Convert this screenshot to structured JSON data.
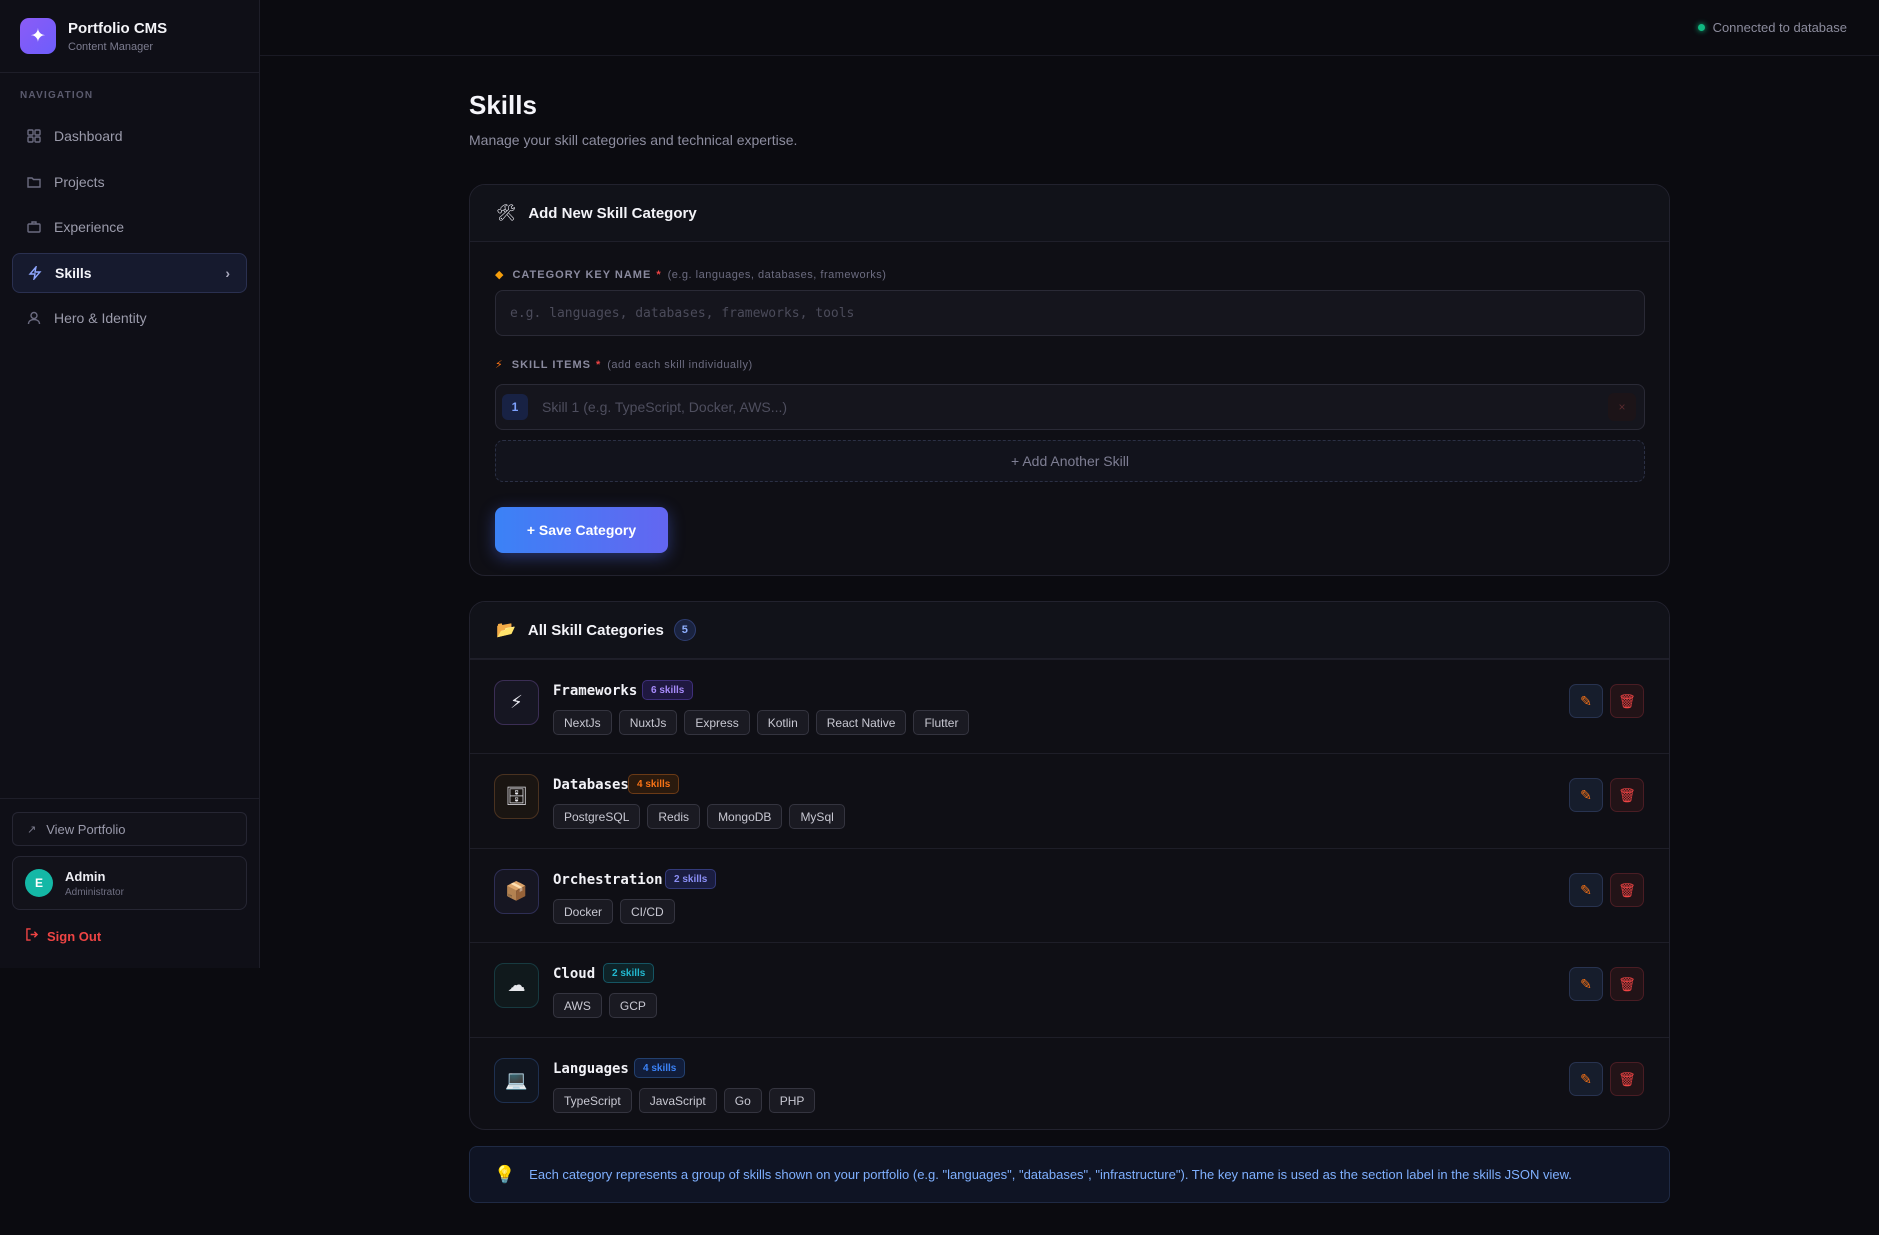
{
  "app": {
    "title": "Portfolio CMS",
    "subtitle": "Content Manager"
  },
  "nav": {
    "heading": "NAVIGATION",
    "items": [
      {
        "label": "Dashboard",
        "icon": "grid-icon"
      },
      {
        "label": "Projects",
        "icon": "folder-icon"
      },
      {
        "label": "Experience",
        "icon": "briefcase-icon"
      },
      {
        "label": "Skills",
        "icon": "bolt-icon",
        "active": true
      },
      {
        "label": "Hero & Identity",
        "icon": "user-icon"
      }
    ]
  },
  "sidebar_footer": {
    "view_portfolio": "View Portfolio",
    "user": {
      "initial": "E",
      "name": "Admin",
      "role": "Administrator"
    },
    "sign_out": "Sign Out"
  },
  "topbar": {
    "status": "Connected to database"
  },
  "page": {
    "title": "Skills",
    "subtitle": "Manage your skill categories and technical expertise."
  },
  "add_form": {
    "title": "Add New Skill Category",
    "key_label": "CATEGORY KEY NAME",
    "key_required": "*",
    "key_hint": "(e.g. languages, databases, frameworks)",
    "key_placeholder": "e.g. languages, databases, frameworks, tools",
    "items_label": "SKILL ITEMS",
    "items_required": "*",
    "items_hint": "(add each skill individually)",
    "skill_number": "1",
    "skill_placeholder": "Skill 1 (e.g. TypeScript, Docker, AWS...)",
    "remove_glyph": "×",
    "add_another": "+ Add Another Skill",
    "save": "+ Save Category"
  },
  "categories_card": {
    "title": "All Skill Categories",
    "count": "5",
    "categories": [
      {
        "name": "Frameworks",
        "badge": "6 skills",
        "icon": "⚡",
        "skills": [
          "NextJs",
          "NuxtJs",
          "Express",
          "Kotlin",
          "React Native",
          "Flutter"
        ]
      },
      {
        "name": "Databases",
        "badge": "4 skills",
        "icon": "🗄",
        "skills": [
          "PostgreSQL",
          "Redis",
          "MongoDB",
          "MySql"
        ]
      },
      {
        "name": "Orchestration",
        "badge": "2 skills",
        "icon": "📦",
        "skills": [
          "Docker",
          "CI/CD"
        ]
      },
      {
        "name": "Cloud",
        "badge": "2 skills",
        "icon": "☁",
        "skills": [
          "AWS",
          "GCP"
        ]
      },
      {
        "name": "Languages",
        "badge": "4 skills",
        "icon": "💻",
        "skills": [
          "TypeScript",
          "JavaScript",
          "Go",
          "PHP"
        ]
      }
    ]
  },
  "info": {
    "text": "Each category represents a group of skills shown on your portfolio (e.g. \"languages\", \"databases\", \"infrastructure\"). The key name is used as the section label in the skills JSON view."
  },
  "colors": {
    "accent": "#3b82f6",
    "brand": "#8b5cf6",
    "danger": "#ef4444",
    "success": "#10b981"
  }
}
